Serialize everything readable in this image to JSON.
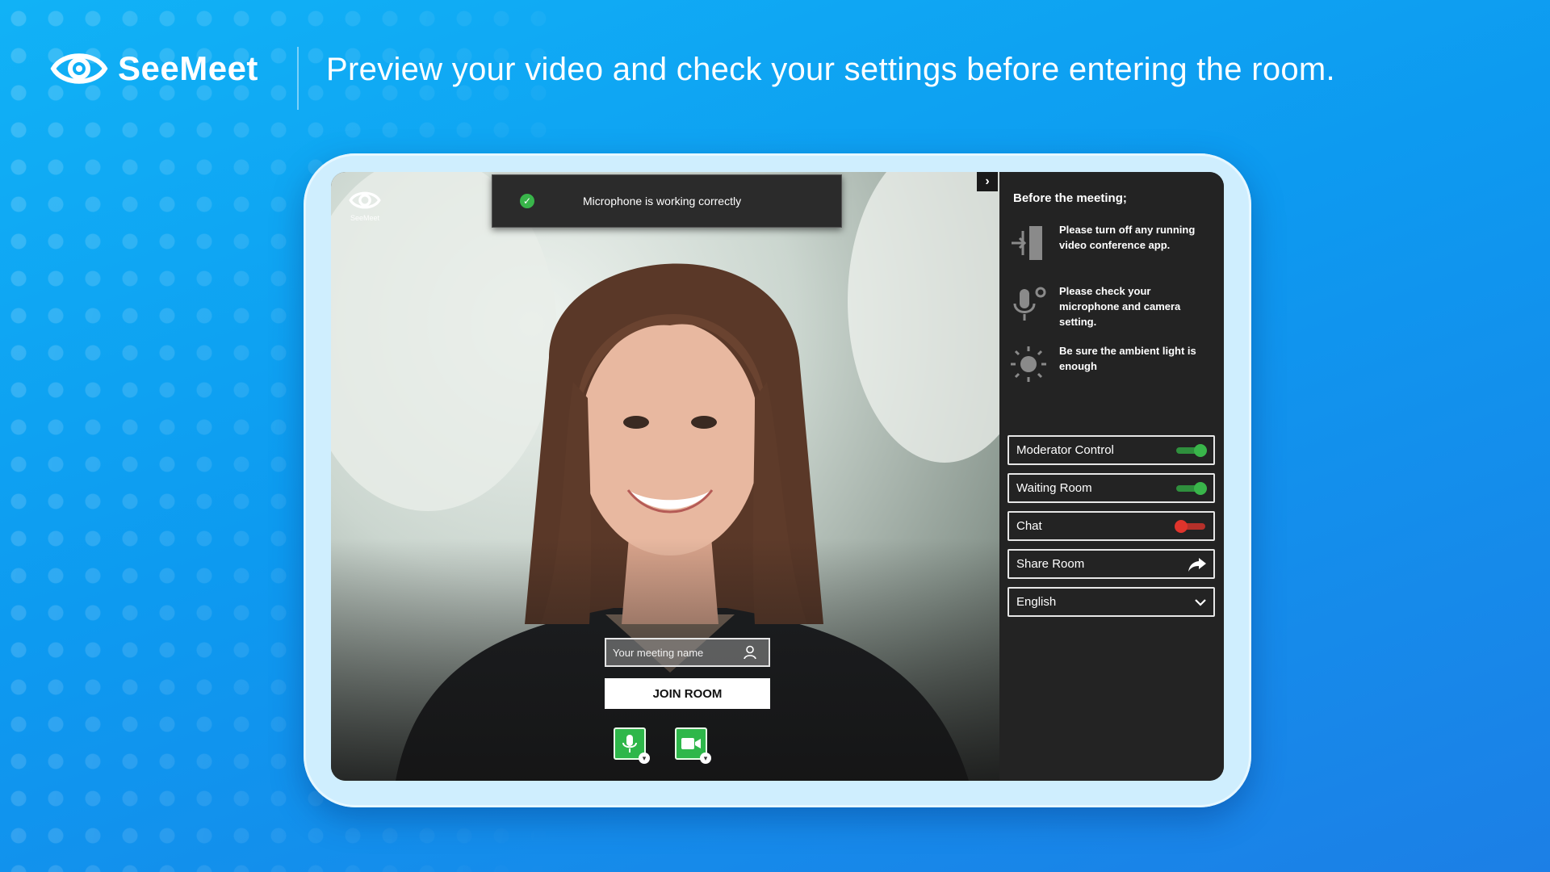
{
  "header": {
    "brand_name": "SeeMeet",
    "tagline": "Preview your video and check your settings before entering the room."
  },
  "toast": {
    "message": "Microphone is working correctly",
    "status_color": "#39b54a"
  },
  "screen_logo": {
    "label": "SeeMeet"
  },
  "join": {
    "name_placeholder": "Your meeting name",
    "name_value": "",
    "button_label": "JOIN ROOM"
  },
  "media": {
    "microphone": {
      "icon": "microphone-icon",
      "enabled": true
    },
    "camera": {
      "icon": "video-camera-icon",
      "enabled": true
    }
  },
  "sidebar": {
    "title": "Before the meeting;",
    "tips": [
      {
        "icon": "exit-door-icon",
        "text": "Please turn off any running video conference app."
      },
      {
        "icon": "microphone-settings-icon",
        "text": "Please check your microphone and camera setting."
      },
      {
        "icon": "sun-icon",
        "text": "Be sure the ambient light is enough"
      }
    ],
    "options": {
      "moderator_control": {
        "label": "Moderator Control",
        "on": true
      },
      "waiting_room": {
        "label": "Waiting Room",
        "on": true
      },
      "chat": {
        "label": "Chat",
        "on": false
      },
      "share_room": {
        "label": "Share Room",
        "icon": "share-arrow-icon"
      },
      "language": {
        "selected": "English",
        "icon": "chevron-down-icon"
      }
    }
  },
  "colors": {
    "toggle_on": "#39b54a",
    "toggle_off": "#e0342c",
    "accent_background": "#0d9af0"
  }
}
